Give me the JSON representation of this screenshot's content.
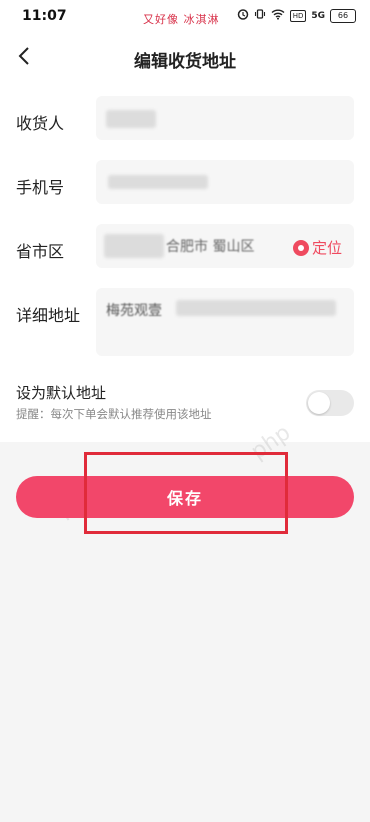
{
  "status_bar": {
    "time": "11:07",
    "overlay_text": "又好像 冰淇淋",
    "hd": "HD",
    "signal": "5G",
    "battery": "66"
  },
  "header": {
    "title": "编辑收货地址"
  },
  "form": {
    "recipient_label": "收货人",
    "phone_label": "手机号",
    "region_label": "省市区",
    "region_value_visible": "合肥市 蜀山区",
    "locate_label": "定位",
    "address_label": "详细地址",
    "address_value_visible": "梅苑观壹",
    "default_title": "设为默认地址",
    "default_hint": "提醒：每次下单会默认推荐使用该地址",
    "default_on": false
  },
  "save_label": "保存",
  "watermark_text": "php",
  "colors": {
    "accent": "#f2476a",
    "highlight": "#e02b3a"
  }
}
